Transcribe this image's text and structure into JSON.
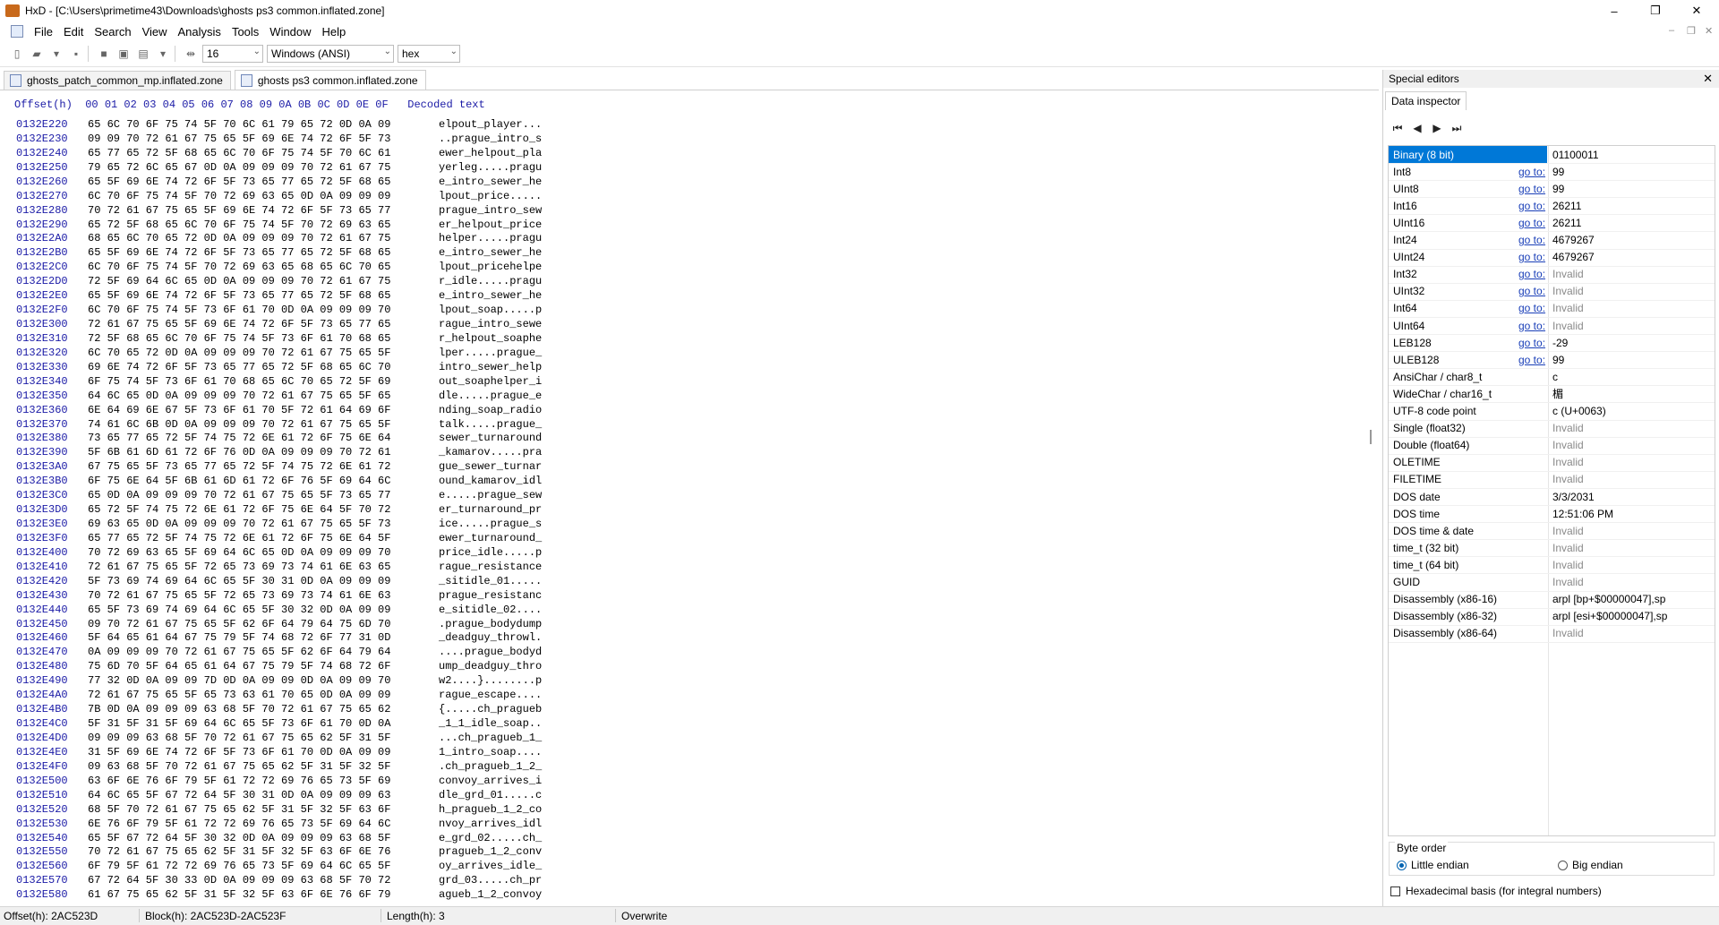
{
  "window": {
    "title": "HxD - [C:\\Users\\primetime43\\Downloads\\ghosts ps3 common.inflated.zone]",
    "controls": [
      "–",
      "❐",
      "✕"
    ]
  },
  "menu": [
    "File",
    "Edit",
    "Search",
    "View",
    "Analysis",
    "Tools",
    "Window",
    "Help"
  ],
  "toolbar": {
    "bytes_per_row": "16",
    "charset": "Windows (ANSI)",
    "base": "hex"
  },
  "tabs": [
    "ghosts_patch_common_mp.inflated.zone",
    "ghosts ps3 common.inflated.zone"
  ],
  "hex": {
    "header": "Offset(h)  00 01 02 03 04 05 06 07 08 09 0A 0B 0C 0D 0E 0F   Decoded text",
    "rows": [
      [
        "0132E220",
        "65 6C 70 6F 75 74 5F 70 6C 61 79 65 72 0D 0A 09",
        "elpout_player..."
      ],
      [
        "0132E230",
        "09 09 70 72 61 67 75 65 5F 69 6E 74 72 6F 5F 73",
        "..prague_intro_s"
      ],
      [
        "0132E240",
        "65 77 65 72 5F 68 65 6C 70 6F 75 74 5F 70 6C 61",
        "ewer_helpout_pla"
      ],
      [
        "0132E250",
        "79 65 72 6C 65 67 0D 0A 09 09 09 70 72 61 67 75",
        "yerleg.....pragu"
      ],
      [
        "0132E260",
        "65 5F 69 6E 74 72 6F 5F 73 65 77 65 72 5F 68 65",
        "e_intro_sewer_he"
      ],
      [
        "0132E270",
        "6C 70 6F 75 74 5F 70 72 69 63 65 0D 0A 09 09 09",
        "lpout_price....."
      ],
      [
        "0132E280",
        "70 72 61 67 75 65 5F 69 6E 74 72 6F 5F 73 65 77",
        "prague_intro_sew"
      ],
      [
        "0132E290",
        "65 72 5F 68 65 6C 70 6F 75 74 5F 70 72 69 63 65",
        "er_helpout_price"
      ],
      [
        "0132E2A0",
        "68 65 6C 70 65 72 0D 0A 09 09 09 70 72 61 67 75",
        "helper.....pragu"
      ],
      [
        "0132E2B0",
        "65 5F 69 6E 74 72 6F 5F 73 65 77 65 72 5F 68 65",
        "e_intro_sewer_he"
      ],
      [
        "0132E2C0",
        "6C 70 6F 75 74 5F 70 72 69 63 65 68 65 6C 70 65",
        "lpout_pricehelpe"
      ],
      [
        "0132E2D0",
        "72 5F 69 64 6C 65 0D 0A 09 09 09 70 72 61 67 75",
        "r_idle.....pragu"
      ],
      [
        "0132E2E0",
        "65 5F 69 6E 74 72 6F 5F 73 65 77 65 72 5F 68 65",
        "e_intro_sewer_he"
      ],
      [
        "0132E2F0",
        "6C 70 6F 75 74 5F 73 6F 61 70 0D 0A 09 09 09 70",
        "lpout_soap.....p"
      ],
      [
        "0132E300",
        "72 61 67 75 65 5F 69 6E 74 72 6F 5F 73 65 77 65",
        "rague_intro_sewe"
      ],
      [
        "0132E310",
        "72 5F 68 65 6C 70 6F 75 74 5F 73 6F 61 70 68 65",
        "r_helpout_soaphe"
      ],
      [
        "0132E320",
        "6C 70 65 72 0D 0A 09 09 09 70 72 61 67 75 65 5F",
        "lper.....prague_"
      ],
      [
        "0132E330",
        "69 6E 74 72 6F 5F 73 65 77 65 72 5F 68 65 6C 70",
        "intro_sewer_help"
      ],
      [
        "0132E340",
        "6F 75 74 5F 73 6F 61 70 68 65 6C 70 65 72 5F 69",
        "out_soaphelper_i"
      ],
      [
        "0132E350",
        "64 6C 65 0D 0A 09 09 09 70 72 61 67 75 65 5F 65",
        "dle.....prague_e"
      ],
      [
        "0132E360",
        "6E 64 69 6E 67 5F 73 6F 61 70 5F 72 61 64 69 6F",
        "nding_soap_radio"
      ],
      [
        "0132E370",
        "74 61 6C 6B 0D 0A 09 09 09 70 72 61 67 75 65 5F",
        "talk.....prague_"
      ],
      [
        "0132E380",
        "73 65 77 65 72 5F 74 75 72 6E 61 72 6F 75 6E 64",
        "sewer_turnaround"
      ],
      [
        "0132E390",
        "5F 6B 61 6D 61 72 6F 76 0D 0A 09 09 09 70 72 61",
        "_kamarov.....pra"
      ],
      [
        "0132E3A0",
        "67 75 65 5F 73 65 77 65 72 5F 74 75 72 6E 61 72",
        "gue_sewer_turnar"
      ],
      [
        "0132E3B0",
        "6F 75 6E 64 5F 6B 61 6D 61 72 6F 76 5F 69 64 6C",
        "ound_kamarov_idl"
      ],
      [
        "0132E3C0",
        "65 0D 0A 09 09 09 70 72 61 67 75 65 5F 73 65 77",
        "e.....prague_sew"
      ],
      [
        "0132E3D0",
        "65 72 5F 74 75 72 6E 61 72 6F 75 6E 64 5F 70 72",
        "er_turnaround_pr"
      ],
      [
        "0132E3E0",
        "69 63 65 0D 0A 09 09 09 70 72 61 67 75 65 5F 73",
        "ice.....prague_s"
      ],
      [
        "0132E3F0",
        "65 77 65 72 5F 74 75 72 6E 61 72 6F 75 6E 64 5F",
        "ewer_turnaround_"
      ],
      [
        "0132E400",
        "70 72 69 63 65 5F 69 64 6C 65 0D 0A 09 09 09 70",
        "price_idle.....p"
      ],
      [
        "0132E410",
        "72 61 67 75 65 5F 72 65 73 69 73 74 61 6E 63 65",
        "rague_resistance"
      ],
      [
        "0132E420",
        "5F 73 69 74 69 64 6C 65 5F 30 31 0D 0A 09 09 09",
        "_sitidle_01....."
      ],
      [
        "0132E430",
        "70 72 61 67 75 65 5F 72 65 73 69 73 74 61 6E 63",
        "prague_resistanc"
      ],
      [
        "0132E440",
        "65 5F 73 69 74 69 64 6C 65 5F 30 32 0D 0A 09 09",
        "e_sitidle_02...."
      ],
      [
        "0132E450",
        "09 70 72 61 67 75 65 5F 62 6F 64 79 64 75 6D 70",
        ".prague_bodydump"
      ],
      [
        "0132E460",
        "5F 64 65 61 64 67 75 79 5F 74 68 72 6F 77 31 0D",
        "_deadguy_throwl."
      ],
      [
        "0132E470",
        "0A 09 09 09 70 72 61 67 75 65 5F 62 6F 64 79 64",
        "....prague_bodyd"
      ],
      [
        "0132E480",
        "75 6D 70 5F 64 65 61 64 67 75 79 5F 74 68 72 6F",
        "ump_deadguy_thro"
      ],
      [
        "0132E490",
        "77 32 0D 0A 09 09 7D 0D 0A 09 09 0D 0A 09 09 70",
        "w2....}........p"
      ],
      [
        "0132E4A0",
        "72 61 67 75 65 5F 65 73 63 61 70 65 0D 0A 09 09",
        "rague_escape...."
      ],
      [
        "0132E4B0",
        "7B 0D 0A 09 09 09 63 68 5F 70 72 61 67 75 65 62",
        "{.....ch_pragueb"
      ],
      [
        "0132E4C0",
        "5F 31 5F 31 5F 69 64 6C 65 5F 73 6F 61 70 0D 0A",
        "_1_1_idle_soap.."
      ],
      [
        "0132E4D0",
        "09 09 09 63 68 5F 70 72 61 67 75 65 62 5F 31 5F",
        "...ch_pragueb_1_"
      ],
      [
        "0132E4E0",
        "31 5F 69 6E 74 72 6F 5F 73 6F 61 70 0D 0A 09 09",
        "1_intro_soap...."
      ],
      [
        "0132E4F0",
        "09 63 68 5F 70 72 61 67 75 65 62 5F 31 5F 32 5F",
        ".ch_pragueb_1_2_"
      ],
      [
        "0132E500",
        "63 6F 6E 76 6F 79 5F 61 72 72 69 76 65 73 5F 69",
        "convoy_arrives_i"
      ],
      [
        "0132E510",
        "64 6C 65 5F 67 72 64 5F 30 31 0D 0A 09 09 09 63",
        "dle_grd_01.....c"
      ],
      [
        "0132E520",
        "68 5F 70 72 61 67 75 65 62 5F 31 5F 32 5F 63 6F",
        "h_pragueb_1_2_co"
      ],
      [
        "0132E530",
        "6E 76 6F 79 5F 61 72 72 69 76 65 73 5F 69 64 6C",
        "nvoy_arrives_idl"
      ],
      [
        "0132E540",
        "65 5F 67 72 64 5F 30 32 0D 0A 09 09 09 63 68 5F",
        "e_grd_02.....ch_"
      ],
      [
        "0132E550",
        "70 72 61 67 75 65 62 5F 31 5F 32 5F 63 6F 6E 76",
        "pragueb_1_2_conv"
      ],
      [
        "0132E560",
        "6F 79 5F 61 72 72 69 76 65 73 5F 69 64 6C 65 5F",
        "oy_arrives_idle_"
      ],
      [
        "0132E570",
        "67 72 64 5F 30 33 0D 0A 09 09 09 63 68 5F 70 72",
        "grd_03.....ch_pr"
      ],
      [
        "0132E580",
        "61 67 75 65 62 5F 31 5F 32 5F 63 6F 6E 76 6F 79",
        "agueb_1_2_convoy"
      ]
    ]
  },
  "special_editors": {
    "title": "Special editors",
    "tab": "Data inspector",
    "goto_label": "go to:",
    "rows": [
      {
        "name": "Binary (8 bit)",
        "goto": false,
        "value": "01100011",
        "invalid": false,
        "selected": true
      },
      {
        "name": "Int8",
        "goto": true,
        "value": "99",
        "invalid": false
      },
      {
        "name": "UInt8",
        "goto": true,
        "value": "99",
        "invalid": false
      },
      {
        "name": "Int16",
        "goto": true,
        "value": "26211",
        "invalid": false
      },
      {
        "name": "UInt16",
        "goto": true,
        "value": "26211",
        "invalid": false
      },
      {
        "name": "Int24",
        "goto": true,
        "value": "4679267",
        "invalid": false
      },
      {
        "name": "UInt24",
        "goto": true,
        "value": "4679267",
        "invalid": false
      },
      {
        "name": "Int32",
        "goto": true,
        "value": "Invalid",
        "invalid": true
      },
      {
        "name": "UInt32",
        "goto": true,
        "value": "Invalid",
        "invalid": true
      },
      {
        "name": "Int64",
        "goto": true,
        "value": "Invalid",
        "invalid": true
      },
      {
        "name": "UInt64",
        "goto": true,
        "value": "Invalid",
        "invalid": true
      },
      {
        "name": "LEB128",
        "goto": true,
        "value": "-29",
        "invalid": false
      },
      {
        "name": "ULEB128",
        "goto": true,
        "value": "99",
        "invalid": false
      },
      {
        "name": "AnsiChar / char8_t",
        "goto": false,
        "value": "c",
        "invalid": false
      },
      {
        "name": "WideChar / char16_t",
        "goto": false,
        "value": "楣",
        "invalid": false
      },
      {
        "name": "UTF-8 code point",
        "goto": false,
        "value": "c (U+0063)",
        "invalid": false
      },
      {
        "name": "Single (float32)",
        "goto": false,
        "value": "Invalid",
        "invalid": true
      },
      {
        "name": "Double (float64)",
        "goto": false,
        "value": "Invalid",
        "invalid": true
      },
      {
        "name": "OLETIME",
        "goto": false,
        "value": "Invalid",
        "invalid": true
      },
      {
        "name": "FILETIME",
        "goto": false,
        "value": "Invalid",
        "invalid": true
      },
      {
        "name": "DOS date",
        "goto": false,
        "value": "3/3/2031",
        "invalid": false
      },
      {
        "name": "DOS time",
        "goto": false,
        "value": "12:51:06 PM",
        "invalid": false
      },
      {
        "name": "DOS time & date",
        "goto": false,
        "value": "Invalid",
        "invalid": true
      },
      {
        "name": "time_t (32 bit)",
        "goto": false,
        "value": "Invalid",
        "invalid": true
      },
      {
        "name": "time_t (64 bit)",
        "goto": false,
        "value": "Invalid",
        "invalid": true
      },
      {
        "name": "GUID",
        "goto": false,
        "value": "Invalid",
        "invalid": true
      },
      {
        "name": "Disassembly (x86-16)",
        "goto": false,
        "value": "arpl [bp+$00000047],sp",
        "invalid": false
      },
      {
        "name": "Disassembly (x86-32)",
        "goto": false,
        "value": "arpl [esi+$00000047],sp",
        "invalid": false
      },
      {
        "name": "Disassembly (x86-64)",
        "goto": false,
        "value": "Invalid",
        "invalid": true
      }
    ],
    "byte_order_title": "Byte order",
    "little_endian": "Little endian",
    "big_endian": "Big endian",
    "hex_basis": "Hexadecimal basis (for integral numbers)"
  },
  "status": {
    "offset": "Offset(h): 2AC523D",
    "block": "Block(h): 2AC523D-2AC523F",
    "length": "Length(h): 3",
    "mode": "Overwrite"
  }
}
